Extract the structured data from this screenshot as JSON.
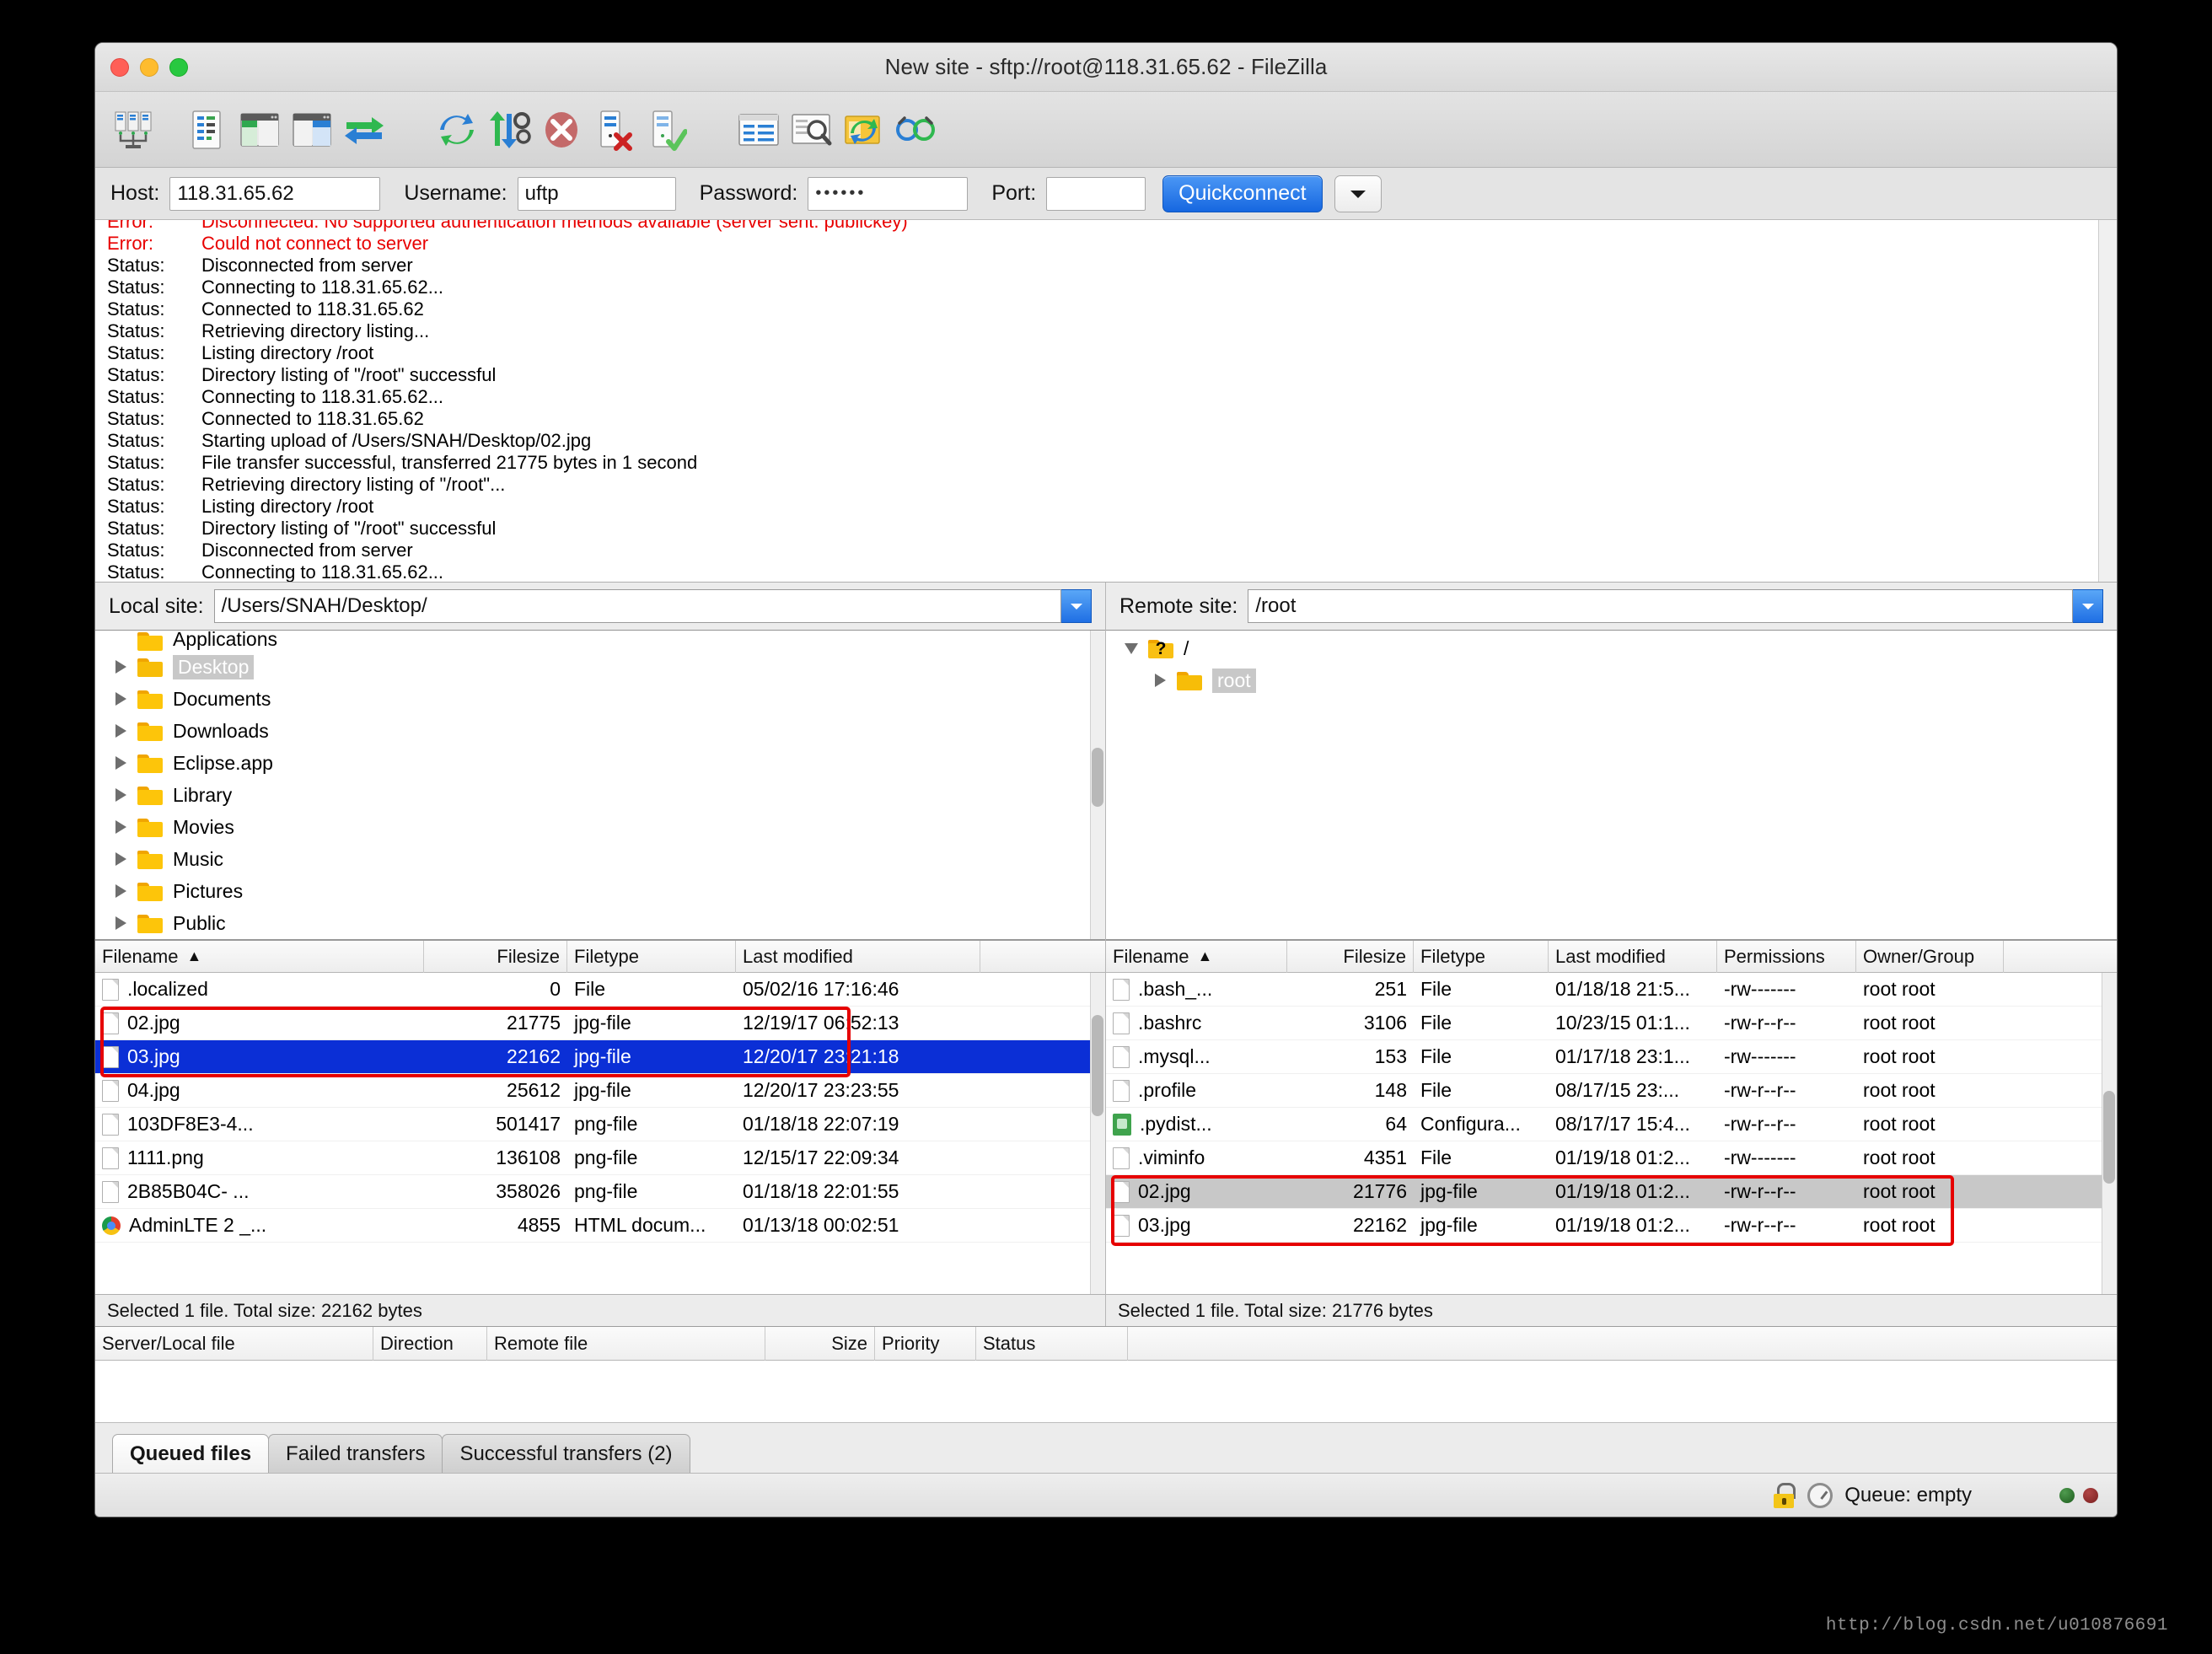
{
  "window": {
    "title": "New site - sftp://root@118.31.65.62 - FileZilla"
  },
  "toolbar": {
    "buttons": [
      {
        "name": "site-manager-icon",
        "title": "Open the Site Manager"
      },
      {
        "name": "toggle-message-log-icon",
        "title": "Toggles the display of the message log"
      },
      {
        "name": "toggle-local-tree-icon",
        "title": "Toggles the display of the local directory tree"
      },
      {
        "name": "toggle-remote-tree-icon",
        "title": "Toggles the display of the remote directory tree"
      },
      {
        "name": "toggle-transfer-queue-icon",
        "title": "Toggles the display of the transfer queue"
      },
      {
        "name": "refresh-icon",
        "title": "Refresh the file and folder lists"
      },
      {
        "name": "process-queue-icon",
        "title": "Process queue"
      },
      {
        "name": "cancel-icon",
        "title": "Cancel current operation"
      },
      {
        "name": "disconnect-icon",
        "title": "Disconnect from server"
      },
      {
        "name": "reconnect-icon",
        "title": "Reconnect to server"
      },
      {
        "name": "filter-icon",
        "title": "Open the directory filter dialog"
      },
      {
        "name": "search-icon",
        "title": "Search remote files"
      },
      {
        "name": "compare-icon",
        "title": "Directory comparison"
      },
      {
        "name": "sync-browse-icon",
        "title": "Synchronized browsing"
      }
    ]
  },
  "quickconnect": {
    "host_label": "Host:",
    "host_value": "118.31.65.62",
    "host_placeholder": "",
    "username_label": "Username:",
    "username_value": "uftp",
    "username_placeholder": "",
    "password_label": "Password:",
    "password_value": "••••••",
    "password_placeholder": "",
    "port_label": "Port:",
    "port_value": "",
    "port_placeholder": "",
    "connect_label": "Quickconnect",
    "dropdown_icon": "chevron-down-icon"
  },
  "log": {
    "lines": [
      {
        "level": "Error:",
        "message": "Disconnected: No supported authentication methods available (server sent: publickey)",
        "type": "error"
      },
      {
        "level": "Error:",
        "message": "Could not connect to server",
        "type": "error"
      },
      {
        "level": "Status:",
        "message": "Disconnected from server",
        "type": "status"
      },
      {
        "level": "Status:",
        "message": "Connecting to 118.31.65.62...",
        "type": "status"
      },
      {
        "level": "Status:",
        "message": "Connected to 118.31.65.62",
        "type": "status"
      },
      {
        "level": "Status:",
        "message": "Retrieving directory listing...",
        "type": "status"
      },
      {
        "level": "Status:",
        "message": "Listing directory /root",
        "type": "status"
      },
      {
        "level": "Status:",
        "message": "Directory listing of \"/root\" successful",
        "type": "status"
      },
      {
        "level": "Status:",
        "message": "Connecting to 118.31.65.62...",
        "type": "status"
      },
      {
        "level": "Status:",
        "message": "Connected to 118.31.65.62",
        "type": "status"
      },
      {
        "level": "Status:",
        "message": "Starting upload of /Users/SNAH/Desktop/02.jpg",
        "type": "status"
      },
      {
        "level": "Status:",
        "message": "File transfer successful, transferred 21775 bytes in 1 second",
        "type": "status"
      },
      {
        "level": "Status:",
        "message": "Retrieving directory listing of \"/root\"...",
        "type": "status"
      },
      {
        "level": "Status:",
        "message": "Listing directory /root",
        "type": "status"
      },
      {
        "level": "Status:",
        "message": "Directory listing of \"/root\" successful",
        "type": "status"
      },
      {
        "level": "Status:",
        "message": "Disconnected from server",
        "type": "status"
      },
      {
        "level": "Status:",
        "message": "Connecting to 118.31.65.62...",
        "type": "status"
      }
    ]
  },
  "local": {
    "path_label": "Local site:",
    "path_value": "/Users/SNAH/Desktop/",
    "tree": [
      {
        "label": "Applications",
        "selected": false,
        "expandable": true,
        "partial": true
      },
      {
        "label": "Desktop",
        "selected": true,
        "expandable": true
      },
      {
        "label": "Documents",
        "selected": false,
        "expandable": true
      },
      {
        "label": "Downloads",
        "selected": false,
        "expandable": true
      },
      {
        "label": "Eclipse.app",
        "selected": false,
        "expandable": true
      },
      {
        "label": "Library",
        "selected": false,
        "expandable": true
      },
      {
        "label": "Movies",
        "selected": false,
        "expandable": true
      },
      {
        "label": "Music",
        "selected": false,
        "expandable": true
      },
      {
        "label": "Pictures",
        "selected": false,
        "expandable": true
      },
      {
        "label": "Public",
        "selected": false,
        "expandable": true
      }
    ],
    "columns": [
      "Filename",
      "Filesize",
      "Filetype",
      "Last modified"
    ],
    "sort_column": "Filename",
    "sort_direction": "asc",
    "rows": [
      {
        "filename": ".localized",
        "filesize": "0",
        "filetype": "File",
        "modified": "05/02/16 17:16:46",
        "icon": "file-icon",
        "state": "normal"
      },
      {
        "filename": "02.jpg",
        "filesize": "21775",
        "filetype": "jpg-file",
        "modified": "12/19/17 06:52:13",
        "icon": "file-icon",
        "state": "normal"
      },
      {
        "filename": "03.jpg",
        "filesize": "22162",
        "filetype": "jpg-file",
        "modified": "12/20/17 23:21:18",
        "icon": "file-icon",
        "state": "selected"
      },
      {
        "filename": "04.jpg",
        "filesize": "25612",
        "filetype": "jpg-file",
        "modified": "12/20/17 23:23:55",
        "icon": "file-icon",
        "state": "normal"
      },
      {
        "filename": "103DF8E3-4...",
        "filesize": "501417",
        "filetype": "png-file",
        "modified": "01/18/18 22:07:19",
        "icon": "file-icon",
        "state": "normal"
      },
      {
        "filename": "1111.png",
        "filesize": "136108",
        "filetype": "png-file",
        "modified": "12/15/17 22:09:34",
        "icon": "file-icon",
        "state": "normal"
      },
      {
        "filename": "2B85B04C- ...",
        "filesize": "358026",
        "filetype": "png-file",
        "modified": "01/18/18 22:01:55",
        "icon": "file-icon",
        "state": "normal"
      },
      {
        "filename": "AdminLTE 2 _...",
        "filesize": "4855",
        "filetype": "HTML docum...",
        "modified": "01/13/18 00:02:51",
        "icon": "chrome-icon",
        "state": "normal"
      }
    ],
    "status": "Selected 1 file. Total size: 22162 bytes"
  },
  "remote": {
    "path_label": "Remote site:",
    "path_value": "/root",
    "tree": [
      {
        "label": "/",
        "selected": false,
        "expanded": true,
        "icon": "unknown-folder-icon"
      },
      {
        "label": "root",
        "selected": true,
        "expanded": false,
        "icon": "folder-icon"
      }
    ],
    "columns": [
      "Filename",
      "Filesize",
      "Filetype",
      "Last modified",
      "Permissions",
      "Owner/Group"
    ],
    "sort_column": "Filename",
    "sort_direction": "asc",
    "rows": [
      {
        "filename": ".bash_...",
        "filesize": "251",
        "filetype": "File",
        "modified": "01/18/18 21:5...",
        "permissions": "-rw-------",
        "owner": "root root",
        "icon": "file-icon",
        "state": "normal"
      },
      {
        "filename": ".bashrc",
        "filesize": "3106",
        "filetype": "File",
        "modified": "10/23/15 01:1...",
        "permissions": "-rw-r--r--",
        "owner": "root root",
        "icon": "file-icon",
        "state": "normal"
      },
      {
        "filename": ".mysql...",
        "filesize": "153",
        "filetype": "File",
        "modified": "01/17/18 23:1...",
        "permissions": "-rw-------",
        "owner": "root root",
        "icon": "file-icon",
        "state": "normal"
      },
      {
        "filename": ".profile",
        "filesize": "148",
        "filetype": "File",
        "modified": "08/17/15 23:...",
        "permissions": "-rw-r--r--",
        "owner": "root root",
        "icon": "file-icon",
        "state": "normal"
      },
      {
        "filename": ".pydist...",
        "filesize": "64",
        "filetype": "Configura...",
        "modified": "08/17/17 15:4...",
        "permissions": "-rw-r--r--",
        "owner": "root root",
        "icon": "python-icon",
        "state": "normal"
      },
      {
        "filename": ".viminfo",
        "filesize": "4351",
        "filetype": "File",
        "modified": "01/19/18 01:2...",
        "permissions": "-rw-------",
        "owner": "root root",
        "icon": "file-icon",
        "state": "normal"
      },
      {
        "filename": "02.jpg",
        "filesize": "21776",
        "filetype": "jpg-file",
        "modified": "01/19/18 01:2...",
        "permissions": "-rw-r--r--",
        "owner": "root root",
        "icon": "file-icon",
        "state": "greyselected"
      },
      {
        "filename": "03.jpg",
        "filesize": "22162",
        "filetype": "jpg-file",
        "modified": "01/19/18 01:2...",
        "permissions": "-rw-r--r--",
        "owner": "root root",
        "icon": "file-icon",
        "state": "normal"
      }
    ],
    "status": "Selected 1 file. Total size: 21776 bytes"
  },
  "queue": {
    "columns": [
      "Server/Local file",
      "Direction",
      "Remote file",
      "",
      "Size",
      "Priority",
      "Status"
    ],
    "rows": []
  },
  "tabs": [
    {
      "label": "Queued files",
      "active": true
    },
    {
      "label": "Failed transfers",
      "active": false
    },
    {
      "label": "Successful transfers (2)",
      "active": false
    }
  ],
  "statusbar": {
    "lock_icon": "lock-icon",
    "speed_icon": "speed-gauge-icon",
    "queue_text": "Queue: empty",
    "led_green": "#3d7a3d",
    "led_red": "#9c2b2b"
  },
  "watermark": "http://blog.csdn.net/u010876691",
  "colors": {
    "accent": "#1667e0",
    "error": "#e80000",
    "selection": "#0b2fd6",
    "highlight_box": "#e60000",
    "folder": "#fdc50a"
  }
}
